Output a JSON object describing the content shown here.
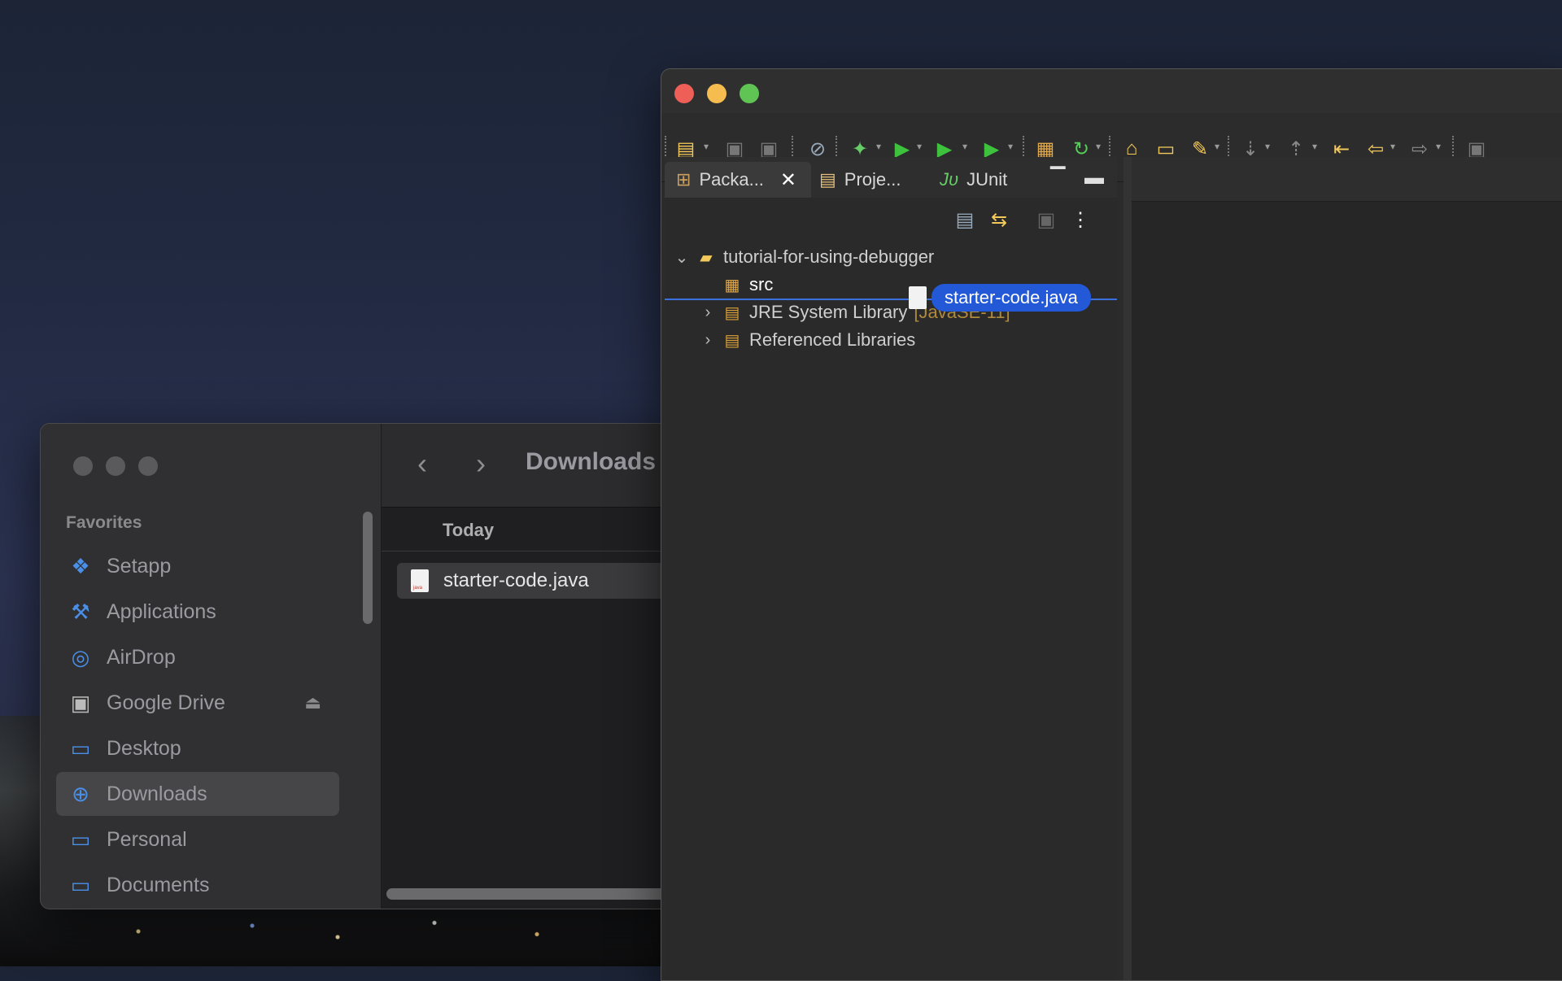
{
  "finder": {
    "sidebar": {
      "section_title": "Favorites",
      "items": [
        {
          "label": "Setapp",
          "icon": "setapp-icon"
        },
        {
          "label": "Applications",
          "icon": "applications-icon"
        },
        {
          "label": "AirDrop",
          "icon": "airdrop-icon"
        },
        {
          "label": "Google Drive",
          "icon": "drive-icon"
        },
        {
          "label": "Desktop",
          "icon": "desktop-icon"
        },
        {
          "label": "Downloads",
          "icon": "downloads-icon",
          "selected": true
        },
        {
          "label": "Personal",
          "icon": "folder-icon"
        },
        {
          "label": "Documents",
          "icon": "folder-icon"
        }
      ]
    },
    "toolbar": {
      "title": "Downloads"
    },
    "group_label": "Today",
    "files": [
      {
        "name": "starter-code.java"
      }
    ]
  },
  "eclipse": {
    "tabs": [
      {
        "label": "Packa...",
        "icon": "package-explorer-icon",
        "active": true
      },
      {
        "label": "Proje...",
        "icon": "project-explorer-icon"
      },
      {
        "label": "JUnit",
        "icon": "junit-icon"
      }
    ],
    "tree": {
      "project": "tutorial-for-using-debugger",
      "src": "src",
      "jre": "JRE System Library",
      "jre_decor": "[JavaSE-11]",
      "ref_libs": "Referenced Libraries"
    },
    "drag_label": "starter-code.java"
  },
  "colors": {
    "traffic_red": "#ed5f57",
    "traffic_yellow": "#f5bd4f",
    "traffic_green": "#5fc454",
    "selection_blue": "#2358d6",
    "accent_blue": "#4a8fe7"
  }
}
